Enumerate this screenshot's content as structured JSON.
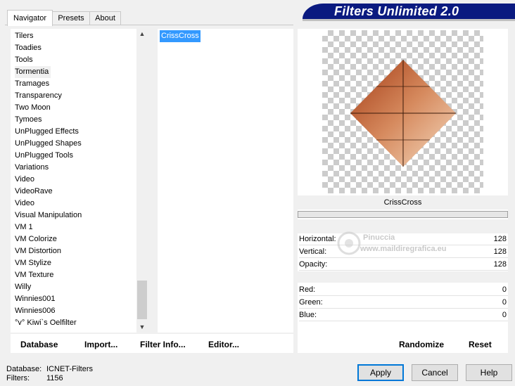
{
  "tabs": [
    {
      "label": "Navigator",
      "active": true
    },
    {
      "label": "Presets",
      "active": false
    },
    {
      "label": "About",
      "active": false
    }
  ],
  "banner": {
    "title": "Filters Unlimited 2.0"
  },
  "categories": {
    "items": [
      "Tilers",
      "Toadies",
      "Tools",
      "Tormentia",
      "Tramages",
      "Transparency",
      "Two Moon",
      "Tymoes",
      "UnPlugged Effects",
      "UnPlugged Shapes",
      "UnPlugged Tools",
      "Variations",
      "Video",
      "VideoRave",
      "Video",
      "Visual Manipulation",
      "VM 1",
      "VM Colorize",
      "VM Distortion",
      "VM Stylize",
      "VM Texture",
      "Willy",
      "Winnies001",
      "Winnies006",
      "°v° Kiwi`s Oelfilter"
    ],
    "selected": "Tormentia"
  },
  "filters": {
    "items": [
      "CrissCross"
    ],
    "selected": "CrissCross"
  },
  "toolbar": {
    "database": "Database",
    "import": "Import...",
    "filter_info": "Filter Info...",
    "editor": "Editor..."
  },
  "preview": {
    "filter_name": "CrissCross"
  },
  "params": {
    "horizontal": {
      "label": "Horizontal:",
      "value": "128"
    },
    "vertical": {
      "label": "Vertical:",
      "value": "128"
    },
    "opacity": {
      "label": "Opacity:",
      "value": "128"
    },
    "red": {
      "label": "Red:",
      "value": "0"
    },
    "green": {
      "label": "Green:",
      "value": "0"
    },
    "blue": {
      "label": "Blue:",
      "value": "0"
    }
  },
  "actions": {
    "randomize": "Randomize",
    "reset": "Reset"
  },
  "status": {
    "database_label": "Database:",
    "database_value": "ICNET-Filters",
    "filters_label": "Filters:",
    "filters_value": "1156"
  },
  "dialog": {
    "apply": "Apply",
    "cancel": "Cancel",
    "help": "Help"
  },
  "watermark": {
    "name": "Pinuccia",
    "url": "www.maildiregrafica.eu"
  },
  "colors": {
    "banner": "#0a1a80",
    "selection": "#3399ff",
    "accent": "#0078d7"
  }
}
